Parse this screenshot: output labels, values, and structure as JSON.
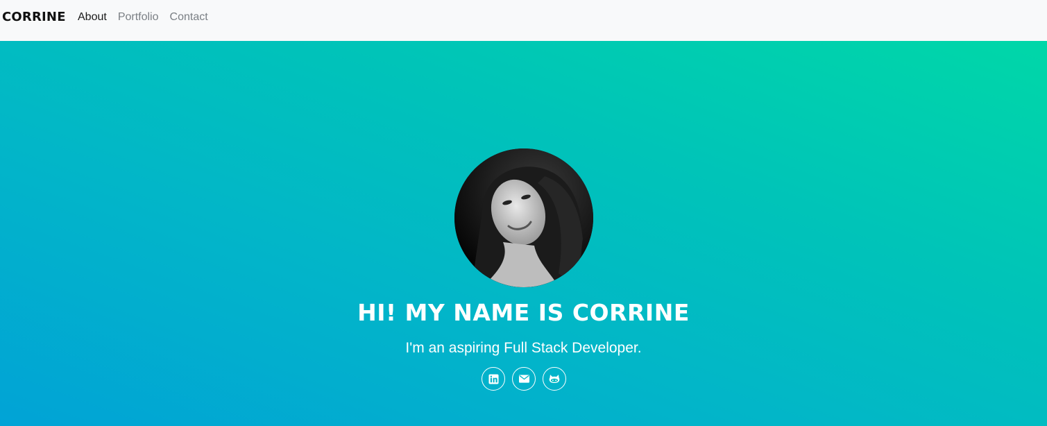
{
  "nav": {
    "brand": "CORRINE",
    "links": [
      {
        "label": "About",
        "active": true
      },
      {
        "label": "Portfolio",
        "active": false
      },
      {
        "label": "Contact",
        "active": false
      }
    ]
  },
  "hero": {
    "title": "HI! MY NAME IS CORRINE",
    "subtitle": "I'm an aspiring Full Stack Developer.",
    "social": [
      {
        "icon": "linkedin-icon"
      },
      {
        "icon": "envelope-icon"
      },
      {
        "icon": "github-icon"
      }
    ]
  },
  "colors": {
    "nav_bg": "#f8f9fa",
    "hero_gradient_start": "#01a3d6",
    "hero_gradient_end": "#00d7a8",
    "text_light": "#ffffff"
  }
}
